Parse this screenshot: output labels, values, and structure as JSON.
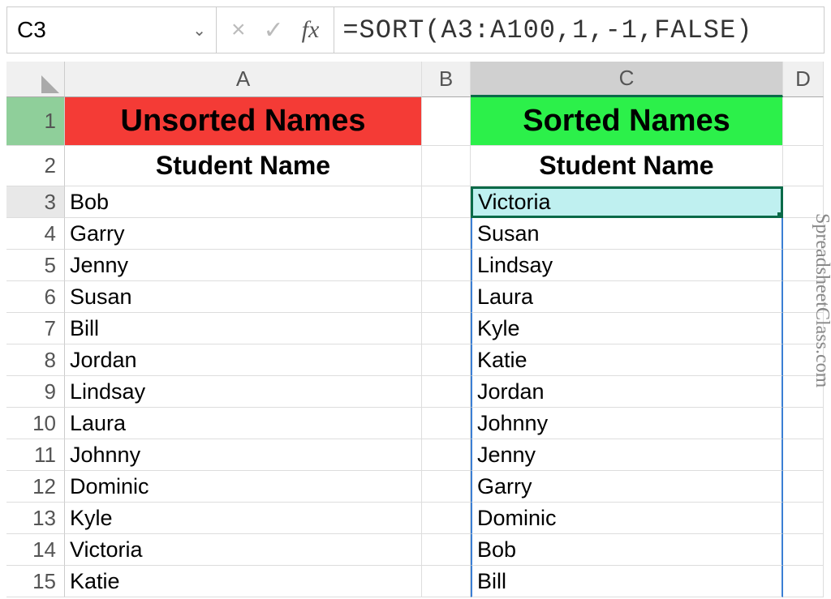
{
  "namebox": "C3",
  "formula": "=SORT(A3:A100,1,-1,FALSE)",
  "columns": {
    "A": "A",
    "B": "B",
    "C": "C",
    "D": "D"
  },
  "row1": {
    "A": "Unsorted Names",
    "C": "Sorted Names"
  },
  "row2": {
    "A": "Student Name",
    "C": "Student Name"
  },
  "rows": [
    {
      "n": "3",
      "A": "Bob",
      "C": "Victoria"
    },
    {
      "n": "4",
      "A": "Garry",
      "C": "Susan"
    },
    {
      "n": "5",
      "A": "Jenny",
      "C": "Lindsay"
    },
    {
      "n": "6",
      "A": "Susan",
      "C": "Laura"
    },
    {
      "n": "7",
      "A": "Bill",
      "C": "Kyle"
    },
    {
      "n": "8",
      "A": "Jordan",
      "C": "Katie"
    },
    {
      "n": "9",
      "A": "Lindsay",
      "C": "Jordan"
    },
    {
      "n": "10",
      "A": "Laura",
      "C": "Johnny"
    },
    {
      "n": "11",
      "A": "Johnny",
      "C": "Jenny"
    },
    {
      "n": "12",
      "A": "Dominic",
      "C": "Garry"
    },
    {
      "n": "13",
      "A": "Kyle",
      "C": "Dominic"
    },
    {
      "n": "14",
      "A": "Victoria",
      "C": "Bob"
    },
    {
      "n": "15",
      "A": "Katie",
      "C": "Bill"
    }
  ],
  "watermark": "SpreadsheetClass.com"
}
